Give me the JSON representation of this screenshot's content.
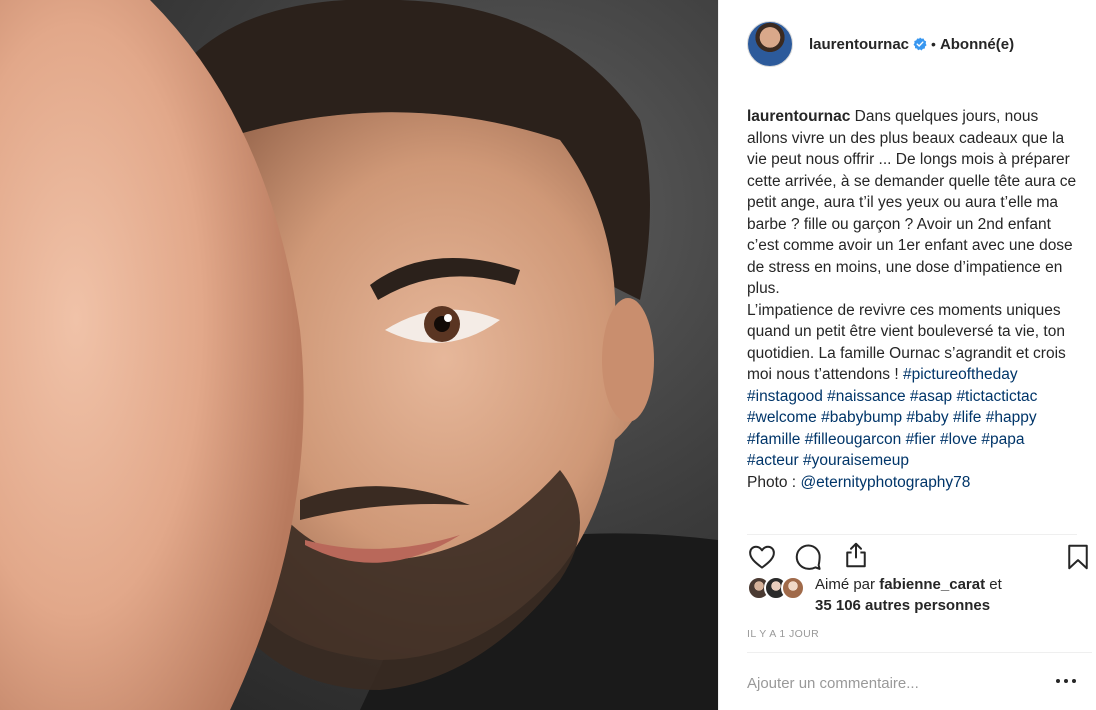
{
  "post": {
    "photo_alt": "",
    "header": {
      "username": "laurentournac",
      "separator": "•",
      "follow_label": "Abonné(e)"
    },
    "caption": {
      "username": "laurentournac",
      "text": "Dans quelques jours, nous allons vivre un des plus beaux cadeaux que la vie peut nous offrir ... De longs mois à préparer cette arrivée, à se demander quelle tête aura ce petit ange, aura t’il yes yeux ou aura t’elle ma barbe ? fille ou garçon ? Avoir un 2nd enfant c’est comme avoir un 1er enfant avec une dose de stress en moins, une dose d’impatience en plus.",
      "text2": "L’impatience de revivre ces moments uniques quand un petit être vient bouleversé ta vie, ton quotidien. La famille Ournac s’agrandit et crois moi nous t’attendons !",
      "hashtags": [
        "#pictureoftheday",
        "#instagood",
        "#naissance",
        "#asap",
        "#tictactictac",
        "#welcome",
        "#babybump",
        "#baby",
        "#life",
        "#happy",
        "#famille",
        "#filleougarcon",
        "#fier",
        "#love",
        "#papa",
        "#acteur",
        "#youraisemeup"
      ],
      "photo_credit_label": "Photo : ",
      "photo_credit_mention": "@eternityphotography78"
    },
    "actions": {
      "like_icon": "heart-outline-icon",
      "comment_icon": "comment-bubble-icon",
      "share_icon": "share-icon",
      "save_icon": "bookmark-icon"
    },
    "likes": {
      "prefix": "Aimé par ",
      "liker": "fabienne_carat",
      "conj": " et",
      "others": "35 106 autres personnes"
    },
    "timestamp": "IL Y A 1 JOUR",
    "comment": {
      "placeholder": "Ajouter un commentaire..."
    },
    "colors": {
      "link": "#003569",
      "text": "#262626",
      "muted": "#999999",
      "verified": "#3897f0"
    }
  }
}
